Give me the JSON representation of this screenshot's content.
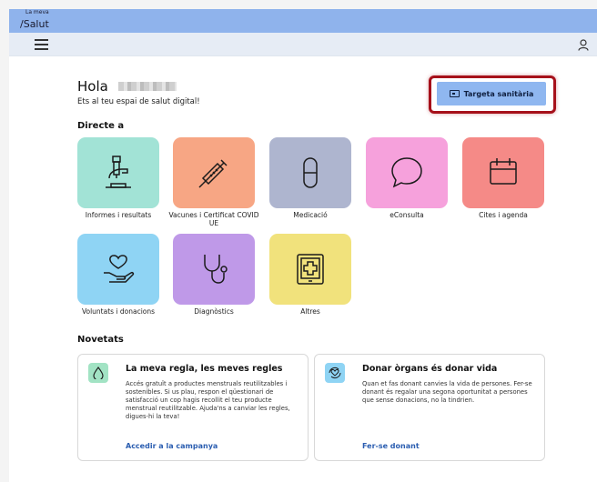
{
  "header": {
    "logo_small": "La meva",
    "logo_big": "/Salut"
  },
  "greeting": {
    "hello": "Hola",
    "subtitle": "Ets al teu espai de salut digital!"
  },
  "health_card_button": {
    "label": "Targeta sanitària"
  },
  "direct_section": {
    "title": "Directe a",
    "tiles": [
      {
        "label": "Informes i resultats",
        "color": "#a2e3d6",
        "icon": "microscope-icon"
      },
      {
        "label": "Vacunes i Certificat COVID UE",
        "color": "#f7a684",
        "icon": "syringe-icon"
      },
      {
        "label": "Medicació",
        "color": "#aeb5cf",
        "icon": "pill-icon"
      },
      {
        "label": "eConsulta",
        "color": "#f6a1dc",
        "icon": "chat-bubble-icon"
      },
      {
        "label": "Cites i agenda",
        "color": "#f58a87",
        "icon": "calendar-icon"
      },
      {
        "label": "Voluntats i donacions",
        "color": "#8fd4f4",
        "icon": "hand-heart-icon"
      },
      {
        "label": "Diagnòstics",
        "color": "#bf99e8",
        "icon": "stethoscope-icon"
      },
      {
        "label": "Altres",
        "color": "#f1e27c",
        "icon": "tablet-cross-icon"
      }
    ]
  },
  "news_section": {
    "title": "Novetats",
    "cards": [
      {
        "title": "La meva regla, les meves regles",
        "body": "Accés gratuït a productes menstruals reutilitzables i sostenibles. Si us plau, respon el qüestionari de satisfacció un cop hagis recollit el teu producte menstrual reutilitzable. Ajuda'ns a canviar les regles, digues-hi la teva!",
        "link": "Accedir a la campanya",
        "icon_color": "#a2e3c4",
        "icon": "drop-icon"
      },
      {
        "title": "Donar òrgans és donar vida",
        "body": "Quan et fas donant canvies la vida de persones. Fer-se donant és regalar una segona oportunitat a persones que sense donacions, no la tindrien.",
        "link": "Fer-se donant",
        "icon_color": "#8fd4f4",
        "icon": "heart-cycle-icon"
      }
    ]
  }
}
